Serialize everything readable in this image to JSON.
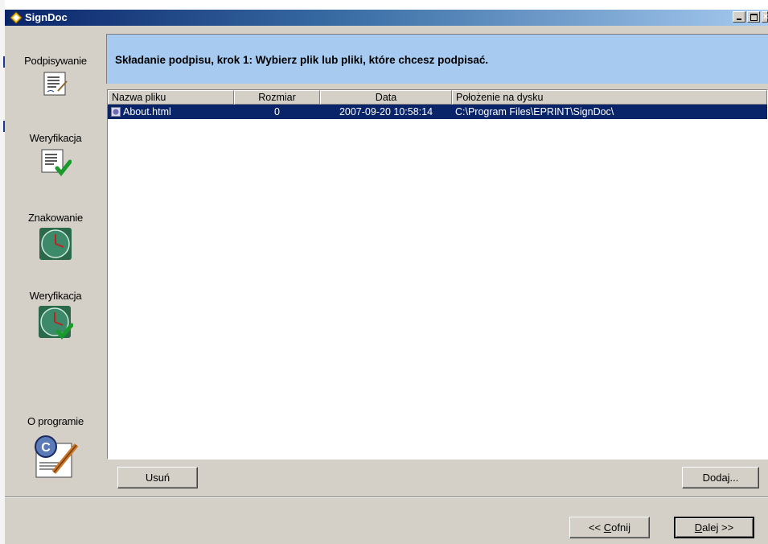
{
  "window": {
    "title": "SignDoc"
  },
  "sidebar": {
    "items": [
      {
        "label": "Podpisywanie",
        "icon": "document-sign-icon"
      },
      {
        "label": "Weryfikacja",
        "icon": "document-verify-icon"
      },
      {
        "label": "Znakowanie",
        "icon": "clock-icon"
      },
      {
        "label": "Weryfikacja",
        "icon": "clock-verify-icon"
      },
      {
        "label": "O programie",
        "icon": "certificate-icon"
      }
    ]
  },
  "main": {
    "heading": "Składanie podpisu, krok 1: Wybierz plik lub pliki, które chcesz podpisać.",
    "table": {
      "columns": [
        "Nazwa pliku",
        "Rozmiar",
        "Data",
        "Położenie na dysku"
      ],
      "rows": [
        {
          "name": "About.html",
          "size": "0",
          "date": "2007-09-20 10:58:14",
          "path": "C:\\Program Files\\EPRINT\\SignDoc\\"
        }
      ]
    },
    "remove_label": "Usuń",
    "add_label": "Dodaj..."
  },
  "footer": {
    "back_label_prefix": "<< ",
    "back_label_accel": "C",
    "back_label_rest": "ofnij",
    "next_label_accel": "D",
    "next_label_rest": "alej >>"
  },
  "colors": {
    "selection": "#0a246a",
    "banner": "#a6caf0",
    "face": "#d4d0c8"
  }
}
